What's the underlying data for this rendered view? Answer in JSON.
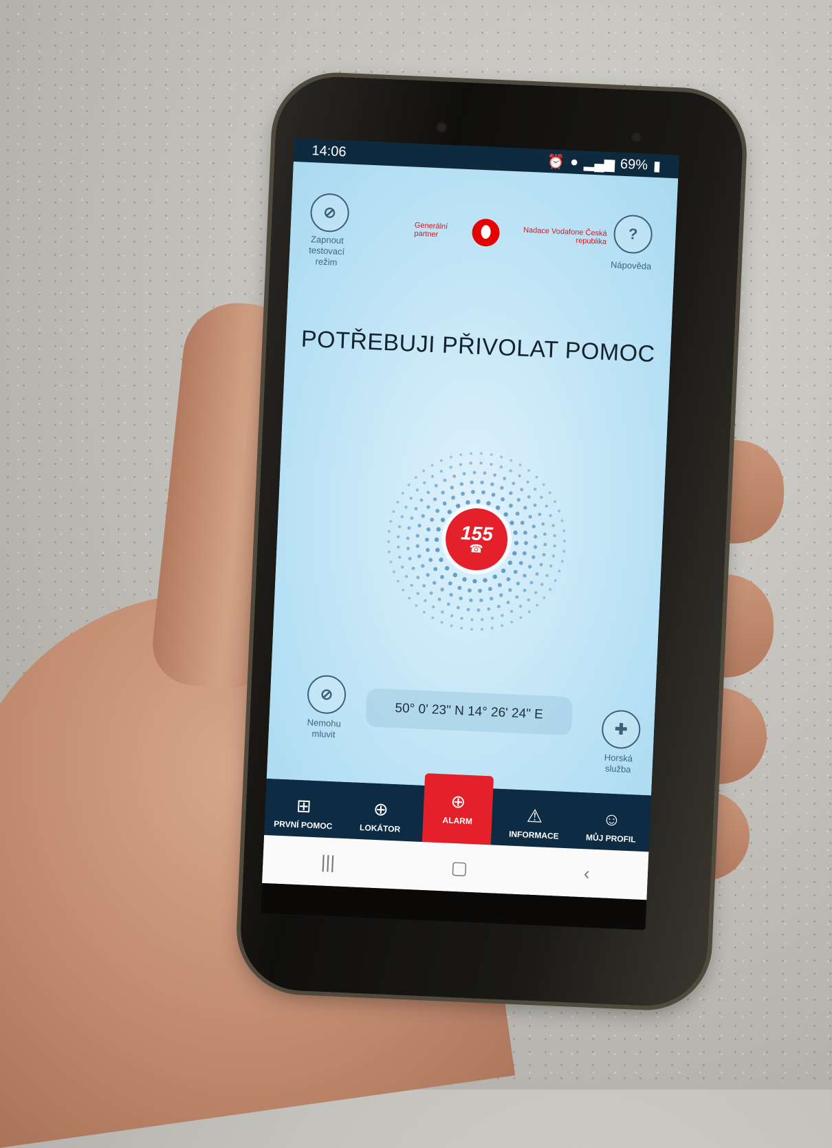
{
  "status_bar": {
    "time": "14:06",
    "battery": "69%"
  },
  "top": {
    "test_mode_label": "Zapnout testovací režim",
    "partner_left": "Generální partner",
    "partner_right": "Nadace Vodafone Česká republika",
    "help_icon": "?",
    "help_label": "Nápověda"
  },
  "main": {
    "headline": "POTŘEBUJI PŘIVOLAT POMOC",
    "emergency_number": "155",
    "coordinates": "50° 0' 23\" N 14° 26' 24\" E",
    "cant_speak_label": "Nemohu mluvit",
    "mountain_service_label": "Horská služba"
  },
  "nav": {
    "items": [
      {
        "label": "PRVNÍ POMOC",
        "icon": "first-aid-kit-icon"
      },
      {
        "label": "LOKÁTOR",
        "icon": "crosshair-icon"
      },
      {
        "label": "ALARM",
        "icon": "plus-circle-icon"
      },
      {
        "label": "INFORMACE",
        "icon": "warning-triangle-icon"
      },
      {
        "label": "MŮJ PROFIL",
        "icon": "user-icon"
      }
    ]
  },
  "colors": {
    "accent": "#e4202a",
    "navbar": "#0d2b42",
    "screen_bg": "#bfe4f6"
  }
}
